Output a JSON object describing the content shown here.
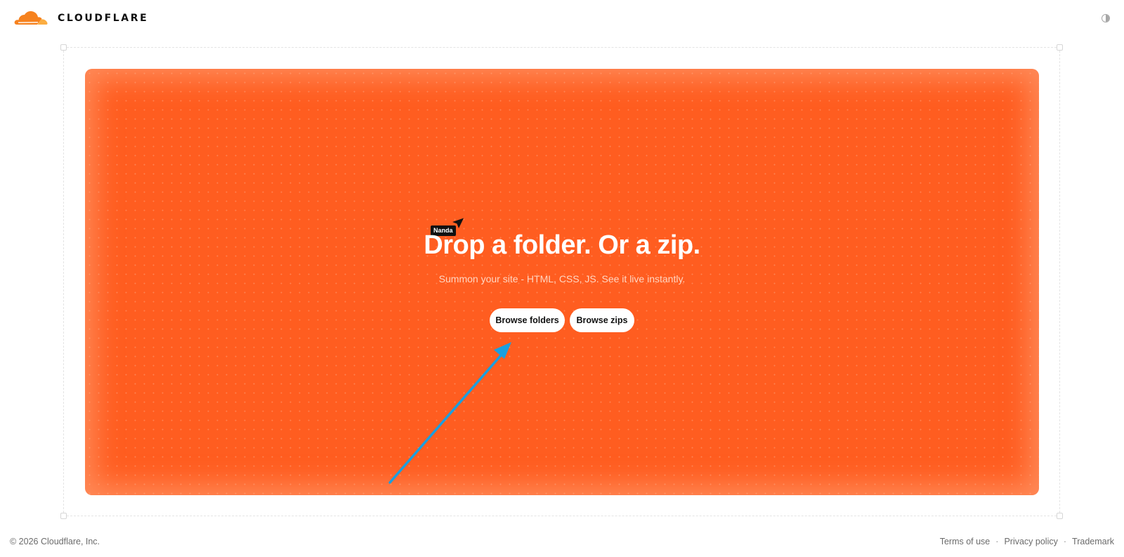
{
  "header": {
    "brand": "CLOUDFLARE",
    "logo_icon": "cloudflare-cloud-logo",
    "theme_toggle_icon": "half-circle-contrast-icon"
  },
  "dropzone": {
    "title": "Drop a folder. Or a zip.",
    "subtitle": "Summon your site - HTML, CSS, JS. See it live instantly.",
    "cursor_label": "Nanda",
    "buttons": {
      "folders": "Browse folders",
      "zips": "Browse zips"
    }
  },
  "footer": {
    "copyright": "© 2026 Cloudflare, Inc.",
    "links": [
      "Terms of use",
      "Privacy policy",
      "Trademark"
    ],
    "separator": "·"
  },
  "colors": {
    "accent": "#ff5d20",
    "logo_orange": "#f6821f",
    "logo_yellow": "#fbad41",
    "annotation_arrow": "#1a9fe0"
  }
}
